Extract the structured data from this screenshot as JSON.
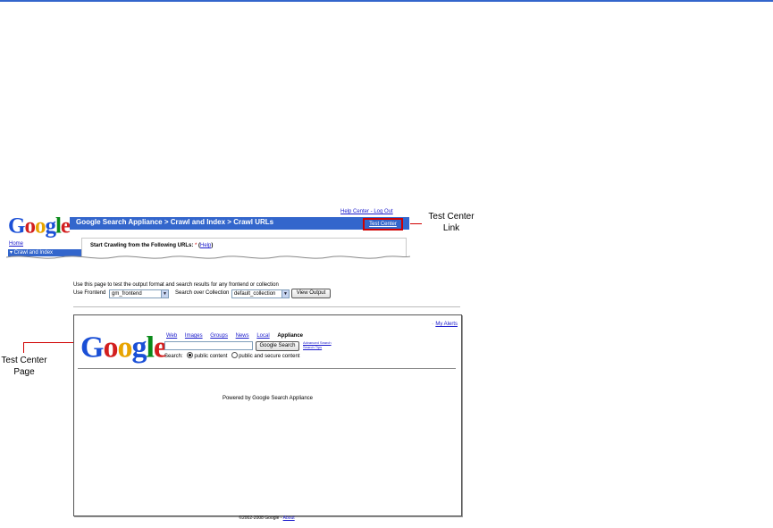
{
  "colors": {
    "accent": "#3366cc",
    "callout": "#d00000",
    "link": "#1a1acc"
  },
  "console": {
    "logo_letters": [
      "G",
      "o",
      "o",
      "g",
      "l",
      "e"
    ],
    "logo_tm": "™",
    "breadcrumb": "Google Search Appliance > Crawl and Index > Crawl URLs",
    "top_links": "Help Center - Log Out",
    "test_center_link": "Test Center",
    "nav_home": "Home",
    "nav_selected": "▾ Crawl and Index",
    "panel_title": "Start Crawling from the Following URLs:",
    "panel_req": "*",
    "panel_help": "Help"
  },
  "callouts": {
    "link": "Test Center Link",
    "page": "Test Center Page"
  },
  "test_center": {
    "description": "Use this page to test the output format and search results for any frontend or collection",
    "frontend_label": "Use Frontend",
    "frontend_value": "gm_frontend",
    "collection_label": "Search over Collection",
    "collection_value": "default_collection",
    "view_button": "View Output"
  },
  "search_page": {
    "my_alerts": "My Alerts",
    "tabs": [
      "Web",
      "Images",
      "Groups",
      "News",
      "Local"
    ],
    "active_tab": "Appliance",
    "search_button": "Google Search",
    "advanced_search": "Advanced Search",
    "search_tips": "Search Tips",
    "search_label": "Search:",
    "option_public": "public content",
    "option_secure": "public and secure content",
    "powered_by": "Powered by Google Search Appliance"
  },
  "footer": {
    "copyright": "©2002-2008 Google -",
    "about": "About"
  }
}
